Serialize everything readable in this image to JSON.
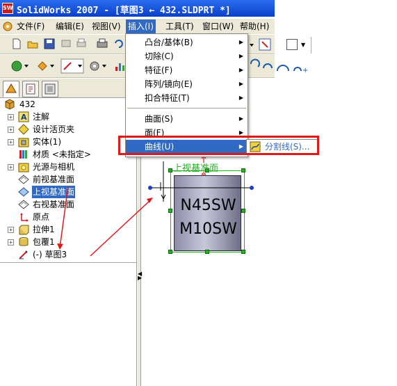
{
  "window": {
    "app_icon_text": "SW",
    "title": "SolidWorks 2007 - [草图3 ← 432.SLDPRT *]"
  },
  "menubar": {
    "items": [
      "文件(F)",
      "编辑(E)",
      "视图(V)",
      "插入(I)",
      "工具(T)",
      "窗口(W)",
      "帮助(H)"
    ],
    "active": "插入(I)"
  },
  "insert_menu": {
    "items": [
      "凸台/基体(B)",
      "切除(C)",
      "特征(F)",
      "阵列/镜向(E)",
      "扣合特征(T)",
      "曲面(S)",
      "面(F)",
      "曲线(U)"
    ],
    "highlighted": "曲线(U)"
  },
  "curve_submenu": {
    "items": [
      "分割线(S)..."
    ]
  },
  "feature_tree": {
    "root": "432",
    "nodes": [
      "注解",
      "设计活页夹",
      "实体(1)",
      "材质 <未指定>",
      "光源与相机",
      "前视基准面",
      "上视基准面",
      "右视基准面",
      "原点",
      "拉伸1",
      "包覆1",
      "(-) 草图3"
    ],
    "selected": "上视基准面"
  },
  "graphics": {
    "plane_label": "上视基准面",
    "part_text_line1": "N45SW",
    "part_text_line2": "M10SW"
  },
  "colors": {
    "selection_blue": "#316ac5",
    "annotation_red": "#e01818",
    "sketch_green": "#22b022"
  }
}
